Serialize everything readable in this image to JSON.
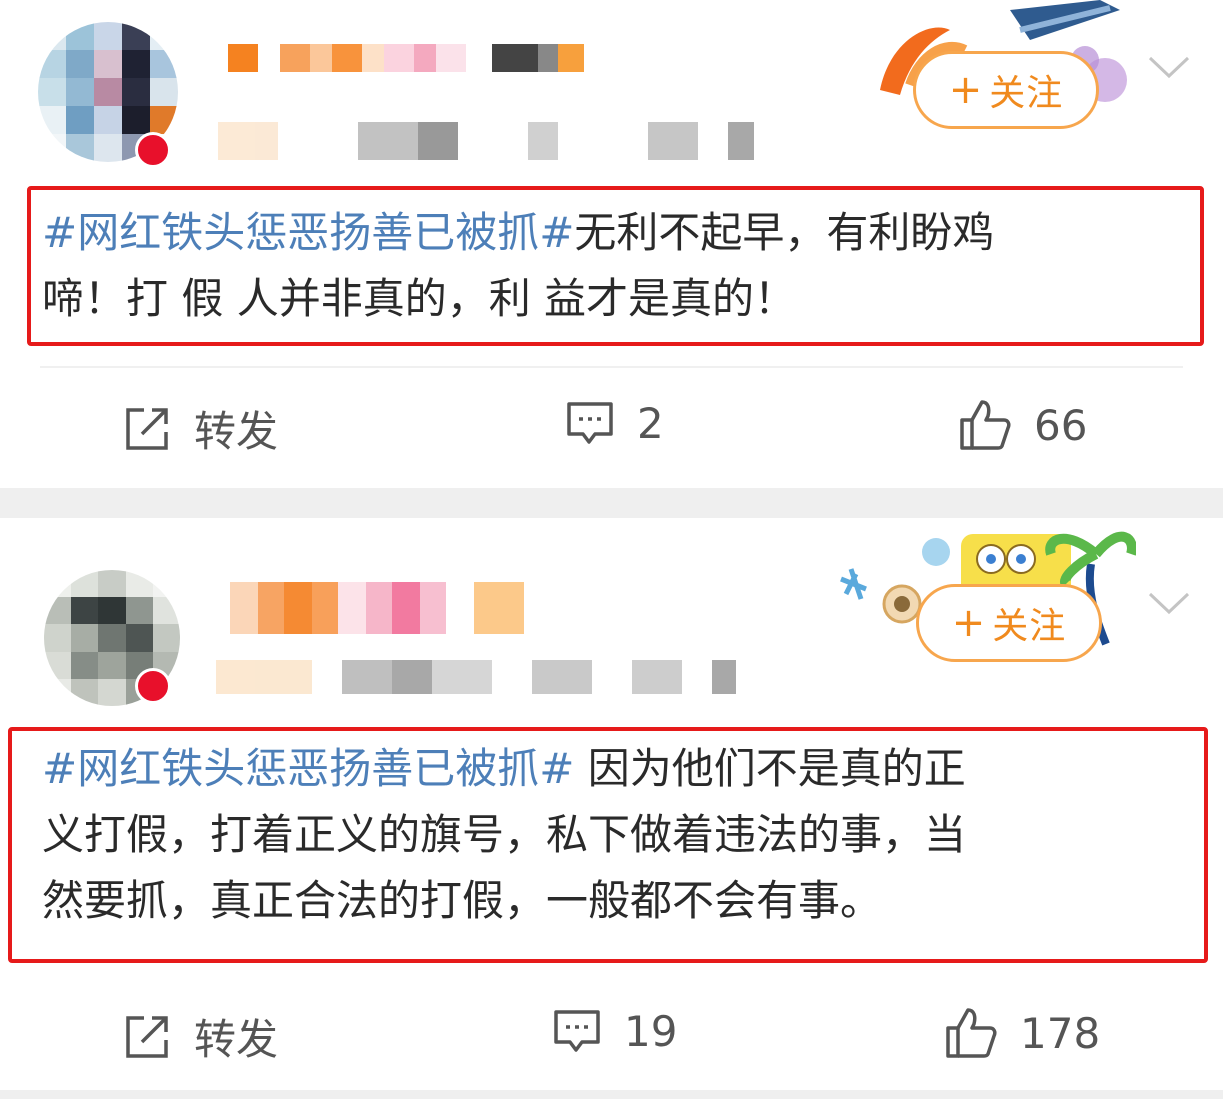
{
  "posts": [
    {
      "follow_label": "关注",
      "hashtag": "#网红铁头惩恶扬善已被抓#",
      "body_line1": "无利不起早，有利盼鸡",
      "body_line2": "啼！打 假 人并非真的，利 益才是真的！",
      "actions": {
        "repost": "转发",
        "comments": "2",
        "likes": "66"
      }
    },
    {
      "follow_label": "关注",
      "hashtag": "#网红铁头惩恶扬善已被抓#",
      "body_line1": " 因为他们不是真的正",
      "body_line2": "义打假，打着正义的旗号，私下做着违法的事，当",
      "body_line3": "然要抓，真正合法的打假，一般都不会有事。",
      "actions": {
        "repost": "转发",
        "comments": "19",
        "likes": "178"
      }
    }
  ],
  "icons": [
    "repost-icon",
    "comment-icon",
    "like-icon",
    "chevron-down-icon",
    "plus-icon"
  ],
  "colors": {
    "accent": "#f08a1e",
    "hashtag": "#4d7fb8",
    "highlight": "#e61a1a"
  }
}
